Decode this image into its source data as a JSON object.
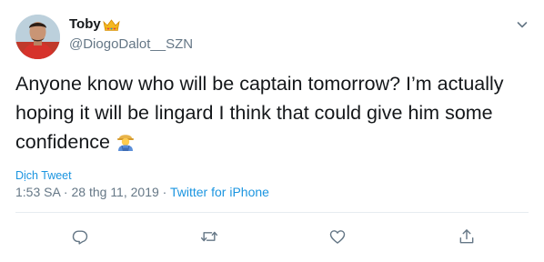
{
  "user": {
    "display_name": "Toby",
    "handle": "@DiogoDalot__SZN"
  },
  "tweet": {
    "text": "Anyone know who will be captain tomorrow? I’m actually hoping it will be lingard I think that could give him some confidence",
    "translate_label": "Dịch Tweet",
    "time": "1:53 SA",
    "date": "28 thg 11, 2019",
    "separator": " · ",
    "source": "Twitter for iPhone"
  },
  "icons": {
    "badge": "crown-icon",
    "caret": "chevron-down-icon",
    "emoji": "man-farmer-emoji",
    "reply": "reply-icon",
    "retweet": "retweet-icon",
    "like": "heart-icon",
    "share": "share-icon"
  },
  "colors": {
    "text": "#14171a",
    "secondary": "#657786",
    "link": "#1b95e0",
    "divider": "#e6ecf0"
  }
}
